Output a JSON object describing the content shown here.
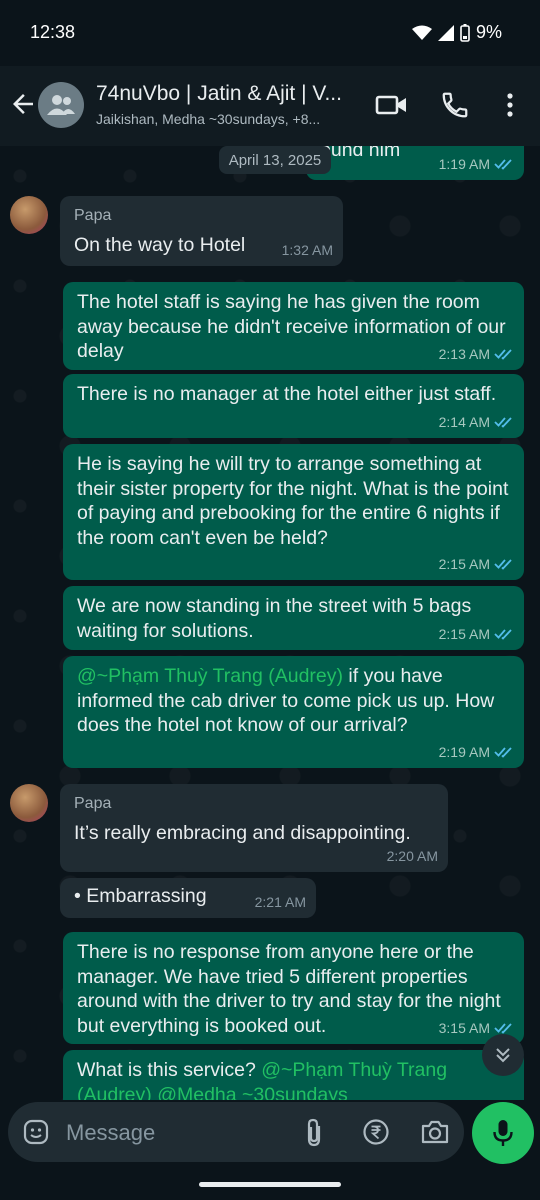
{
  "status": {
    "time": "12:38",
    "battery": "9%"
  },
  "header": {
    "title": "74nuVbo | Jatin & Ajit | V...",
    "subtitle": "Jaikishan, Medha ~30sundays, +8..."
  },
  "date_chip": "April 13, 2025",
  "messages": [
    {
      "type": "outgoing",
      "text": "ound him",
      "time": "1:19 AM"
    },
    {
      "type": "incoming",
      "sender": "Papa",
      "text": "On the way to Hotel",
      "time": "1:32 AM"
    },
    {
      "type": "outgoing",
      "text": "The hotel staff is saying he has given the room away because he didn't receive information of our delay",
      "time": "2:13 AM"
    },
    {
      "type": "outgoing",
      "text": "There is no manager at the hotel either just staff.",
      "time": "2:14 AM"
    },
    {
      "type": "outgoing",
      "text": "He is saying he will try to arrange something at their sister property for the night. What is the point of paying and prebooking for the entire 6 nights if the room can't even be held?",
      "time": "2:15 AM"
    },
    {
      "type": "outgoing",
      "text": "We are now standing in the street with 5 bags waiting for solutions.",
      "time": "2:15 AM"
    },
    {
      "type": "outgoing",
      "mention": "@~Phạm Thuỳ Trang (Audrey)",
      "text": " if you have informed the cab driver to come pick us up. How does the hotel not know of our arrival?",
      "time": "2:19 AM"
    },
    {
      "type": "incoming",
      "sender": "Papa",
      "text": "It’s really embracing and disappointing.",
      "time": "2:20 AM"
    },
    {
      "type": "incoming",
      "text": "• Embarrassing",
      "time": "2:21 AM"
    },
    {
      "type": "outgoing",
      "text": "There is no response from anyone here or the manager. We have tried 5 different properties around with the driver to try and stay for the night but everything is booked out.",
      "time": "3:15 AM"
    },
    {
      "type": "outgoing",
      "text": "What is this service? ",
      "mention": "@~Phạm Thuỳ Trang (Audrey) @Medha ~30sundays",
      "time": ""
    }
  ],
  "input": {
    "placeholder": "Message"
  },
  "colors": {
    "outgoing": "#005c4b",
    "incoming": "#202c33",
    "accent": "#21c063",
    "tick": "#53bdeb"
  }
}
